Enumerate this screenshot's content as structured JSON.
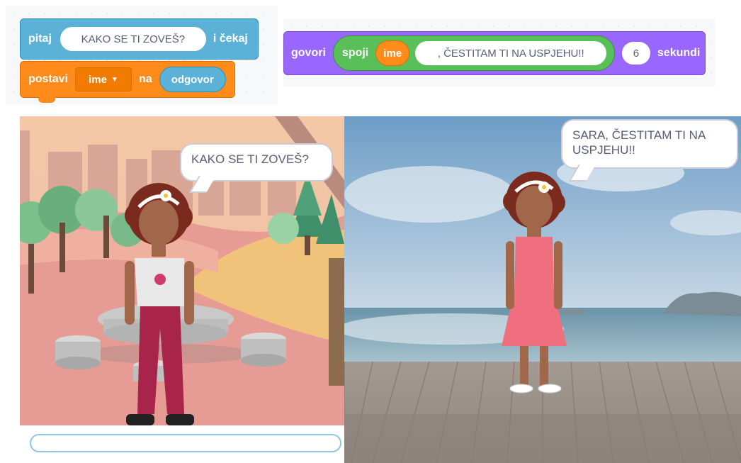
{
  "code": {
    "ask_block": {
      "label": "pitaj",
      "question": "KAKO SE TI ZOVEŠ?",
      "suffix": "i čekaj"
    },
    "set_block": {
      "label": "postavi",
      "variable": "ime",
      "to_label": "na",
      "value": "odgovor"
    },
    "say_block": {
      "label": "govori",
      "join_label": "spoji",
      "join_var": "ime",
      "join_text": ", ČESTITAM TI NA USPJEHU!!",
      "seconds_value": "6",
      "seconds_label": "sekundi"
    }
  },
  "stage_left": {
    "bubble_text": "KAKO SE TI ZOVEŠ?",
    "answer_input_value": ""
  },
  "stage_right": {
    "bubble_text": "SARA, ČESTITAM TI NA USPJEHU!!"
  },
  "colors": {
    "sensing": "#5cb1d6",
    "variables": "#ff8c1a",
    "looks": "#9966ff",
    "operators": "#59c059"
  },
  "icons": {
    "dropdown": "caret-down-icon"
  }
}
